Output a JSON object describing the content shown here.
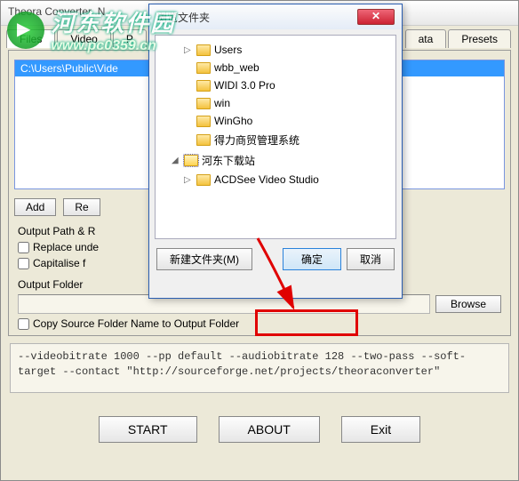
{
  "watermark": {
    "brand_cn": "河东软件园",
    "url": "www.pc0359.cn"
  },
  "window": {
    "title": "Theora Converter .N"
  },
  "tabs": {
    "files": "Files",
    "video": "Video",
    "p": "P",
    "ata": "ata",
    "presets": "Presets"
  },
  "file_list": {
    "selected_path": "C:\\Users\\Public\\Vide"
  },
  "buttons": {
    "add": "Add",
    "re": "Re"
  },
  "output": {
    "path_label": "Output Path & R",
    "replace_unde": "Replace unde",
    "capitalise_f": "Capitalise f",
    "folder_label": "Output Folder",
    "browse": "Browse",
    "copy_source": "Copy Source Folder Name to Output Folder"
  },
  "cmdline": "--videobitrate 1000 --pp default --audiobitrate 128 --two-pass --soft-target --contact \"http://sourceforge.net/projects/theoraconverter\"",
  "bottom": {
    "start": "START",
    "about": "ABOUT",
    "exit": "Exit"
  },
  "dialog": {
    "title": "浏览文件夹",
    "tree": [
      {
        "level": 2,
        "arrow": "▷",
        "label": "Users"
      },
      {
        "level": 2,
        "arrow": "",
        "label": "wbb_web"
      },
      {
        "level": 2,
        "arrow": "",
        "label": "WIDI 3.0 Pro"
      },
      {
        "level": 2,
        "arrow": "",
        "label": "win"
      },
      {
        "level": 2,
        "arrow": "",
        "label": "WinGho"
      },
      {
        "level": 2,
        "arrow": "",
        "label": "得力商贸管理系统"
      },
      {
        "level": 1,
        "arrow": "◢",
        "label": "河东下载站",
        "selected": true
      },
      {
        "level": 2,
        "arrow": "▷",
        "label": "ACDSee Video Studio"
      }
    ],
    "new_folder": "新建文件夹(M)",
    "ok": "确定",
    "cancel": "取消"
  }
}
